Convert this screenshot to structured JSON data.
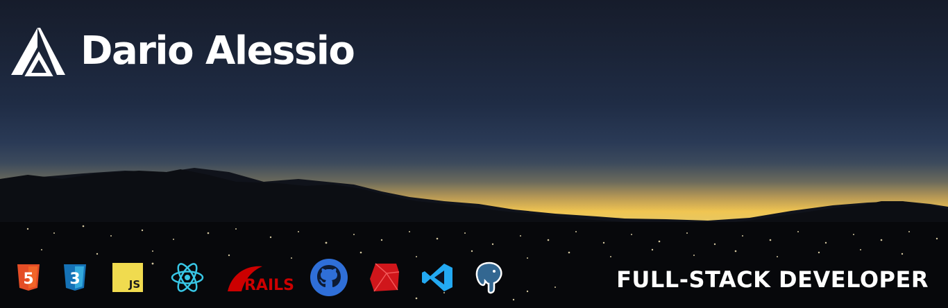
{
  "brand": {
    "name": "Dario Alessio",
    "logo_icon": "triangle-logo-icon"
  },
  "tech_stack": [
    {
      "name": "html5-icon",
      "label": "5",
      "color": "#e44d26"
    },
    {
      "name": "css3-icon",
      "label": "3",
      "color": "#1572b6"
    },
    {
      "name": "javascript-icon",
      "label": "JS",
      "color": "#f0db4f"
    },
    {
      "name": "react-icon",
      "label": "",
      "color": "#38c7e6"
    },
    {
      "name": "rails-icon",
      "label": "RAILS",
      "color": "#cc0000"
    },
    {
      "name": "github-icon",
      "label": "",
      "color": "#2f6fd8"
    },
    {
      "name": "ruby-icon",
      "label": "",
      "color": "#d0161b"
    },
    {
      "name": "vscode-icon",
      "label": "",
      "color": "#23a9f2"
    },
    {
      "name": "postgresql-icon",
      "label": "",
      "color": "#336791"
    }
  ],
  "role": "FULL-STACK DEVELOPER"
}
